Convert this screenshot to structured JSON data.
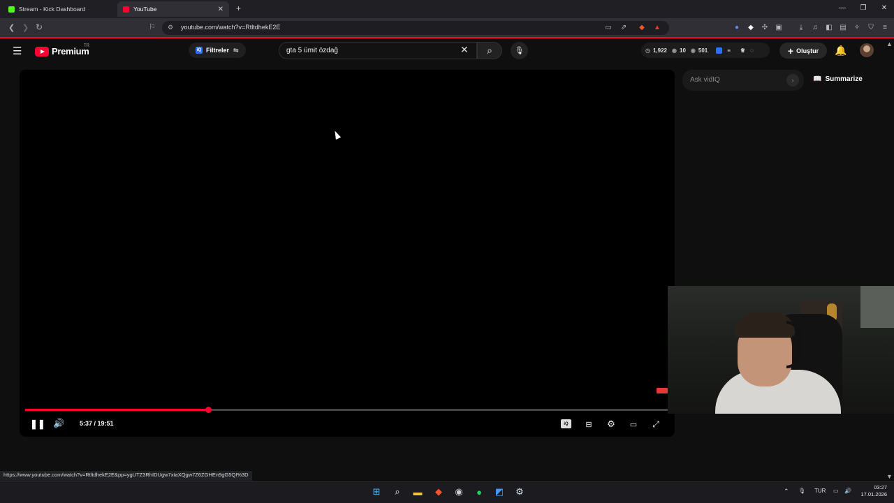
{
  "browser": {
    "tabs": [
      {
        "title": "Stream - Kick Dashboard",
        "favicon_color": "#53fc18"
      },
      {
        "title": "YouTube",
        "favicon_color": "#ff0033"
      }
    ],
    "new_tab": "+",
    "url": "youtube.com/watch?v=RtltdhekE2E",
    "status_url": "https://www.youtube.com/watch?v=RtltdhekE2E&pp=ygUTZ3RhIDUgw7xtaXQgw7Z6ZGHEn9gG5QI%3D"
  },
  "youtube": {
    "logo_text": "Premium",
    "region": "TR",
    "filters_label": "Filtreler",
    "search_query": "gta 5 ümit özdağ",
    "stats": {
      "views": "1,922",
      "likes": "10",
      "score": "501"
    },
    "create_label": "Oluştur"
  },
  "player": {
    "time": "5:37 / 19:51",
    "progress_fraction": 0.284,
    "accent": "#ff0033"
  },
  "sidebar": {
    "ask_placeholder": "Ask vidIQ",
    "summarize_label": "Summarize"
  },
  "taskbar": {
    "language": "TUR",
    "time": "03:27",
    "date": "17.01.2026"
  }
}
